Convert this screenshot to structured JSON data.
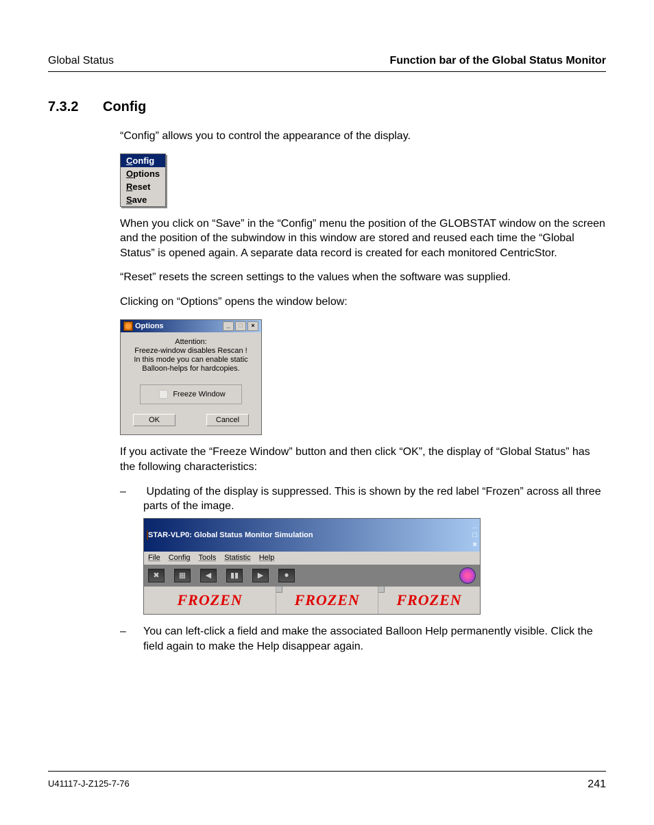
{
  "header": {
    "left": "Global Status",
    "right": "Function bar of the Global Status Monitor"
  },
  "section": {
    "number": "7.3.2",
    "title": "Config"
  },
  "paragraphs": {
    "intro": "“Config” allows you to control the appearance of the display.",
    "save_desc": "When you click on “Save” in the “Config” menu the position of the GLOBSTAT window on the screen and the position of the subwindow in this window are stored and reused each time the “Global Status” is opened again. A separate data record is created for each monitored CentricStor.",
    "reset_desc": "“Reset” resets the screen settings to the values when the software was supplied.",
    "options_intro": "Clicking on “Options” opens the window below:",
    "freeze_desc": "If you activate the “Freeze Window” button and then click “OK”, the display of “Global Status” has the following characteristics:"
  },
  "bullets": {
    "b1": "Updating of the display is suppressed. This is shown by the red label “Frozen” across all three parts of the image.",
    "b2": "You can left-click a field and make the associated Balloon Help permanently visible. Click the field again to make the Help disappear again."
  },
  "config_menu": {
    "title": "Config",
    "items": [
      "Options",
      "Reset",
      "Save"
    ]
  },
  "options_dialog": {
    "title": "Options",
    "attention_lines": {
      "l1": "Attention:",
      "l2": "Freeze-window disables Rescan !",
      "l3": "In this mode you can enable static",
      "l4": "Balloon-helps for hardcopies."
    },
    "checkbox_label": "Freeze Window",
    "ok": "OK",
    "cancel": "Cancel"
  },
  "frozen_window": {
    "title": "STAR-VLP0: Global Status Monitor Simulation",
    "menus": [
      "File",
      "Config",
      "Tools",
      "Statistic",
      "Help"
    ],
    "toolbar_icons": [
      "✖",
      "▦",
      "◀",
      "▮▮",
      "▶",
      "⏺"
    ],
    "frozen_label": "FROZEN"
  },
  "footer": {
    "doc_id": "U41117-J-Z125-7-76",
    "page": "241"
  }
}
